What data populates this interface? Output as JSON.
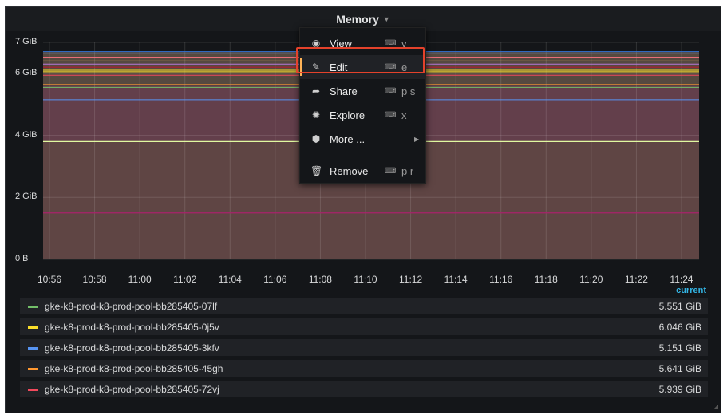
{
  "panel": {
    "title": "Memory",
    "caret_icon": "caret-down-icon",
    "legend_header": "current"
  },
  "colors": {
    "background": "#141619",
    "area_fill": "#6b4451",
    "area_fill_upper": "#5c4f45",
    "series_green": "#73bf69",
    "series_yellow": "#fade2a",
    "series_cyan": "#5794f2",
    "series_orange": "#ff9830",
    "series_red": "#f2495c",
    "accent_highlight": "#e4422b",
    "legend_header": "#33b5e5"
  },
  "chart_data": {
    "type": "area",
    "x": [
      "10:56",
      "10:58",
      "11:00",
      "11:02",
      "11:04",
      "11:06",
      "11:08",
      "11:10",
      "11:12",
      "11:14",
      "11:16",
      "11:18",
      "11:20",
      "11:22",
      "11:24"
    ],
    "y_ticks": [
      "0 B",
      "2 GiB",
      "4 GiB",
      "6 GiB",
      "7 GiB"
    ],
    "ylim_gib": [
      0,
      7
    ],
    "grid": true,
    "series": [
      {
        "name": "gke-k8-prod-k8-prod-pool-bb285405-07lf",
        "color": "#73bf69",
        "current": "5.551 GiB",
        "level_gib": 5.55
      },
      {
        "name": "gke-k8-prod-k8-prod-pool-bb285405-0j5v",
        "color": "#fade2a",
        "current": "6.046 GiB",
        "level_gib": 6.05
      },
      {
        "name": "gke-k8-prod-k8-prod-pool-bb285405-3kfv",
        "color": "#5794f2",
        "current": "5.151 GiB",
        "level_gib": 5.15
      },
      {
        "name": "gke-k8-prod-k8-prod-pool-bb285405-45gh",
        "color": "#ff9830",
        "current": "5.641 GiB",
        "level_gib": 5.64
      },
      {
        "name": "gke-k8-prod-k8-prod-pool-bb285405-72vj",
        "color": "#f2495c",
        "current": "5.939 GiB",
        "level_gib": 5.94
      }
    ],
    "other_lines_gib": [
      6.7,
      6.65,
      6.5,
      6.4,
      6.3,
      6.2,
      6.1,
      3.8,
      1.5
    ]
  },
  "menu": {
    "items": [
      {
        "label": "View",
        "icon": "eye-icon",
        "kbd_icon": "keyboard-icon",
        "shortcut": "v"
      },
      {
        "label": "Edit",
        "icon": "edit-icon",
        "kbd_icon": "keyboard-icon",
        "shortcut": "e"
      },
      {
        "label": "Share",
        "icon": "share-icon",
        "kbd_icon": "keyboard-icon",
        "shortcut": "p s"
      },
      {
        "label": "Explore",
        "icon": "compass-icon",
        "kbd_icon": "keyboard-icon",
        "shortcut": "x"
      },
      {
        "label": "More ...",
        "icon": "cube-icon",
        "submenu_icon": "caret-right-icon"
      },
      {
        "label": "Remove",
        "icon": "trash-icon",
        "kbd_icon": "keyboard-icon",
        "shortcut": "p r"
      }
    ]
  }
}
